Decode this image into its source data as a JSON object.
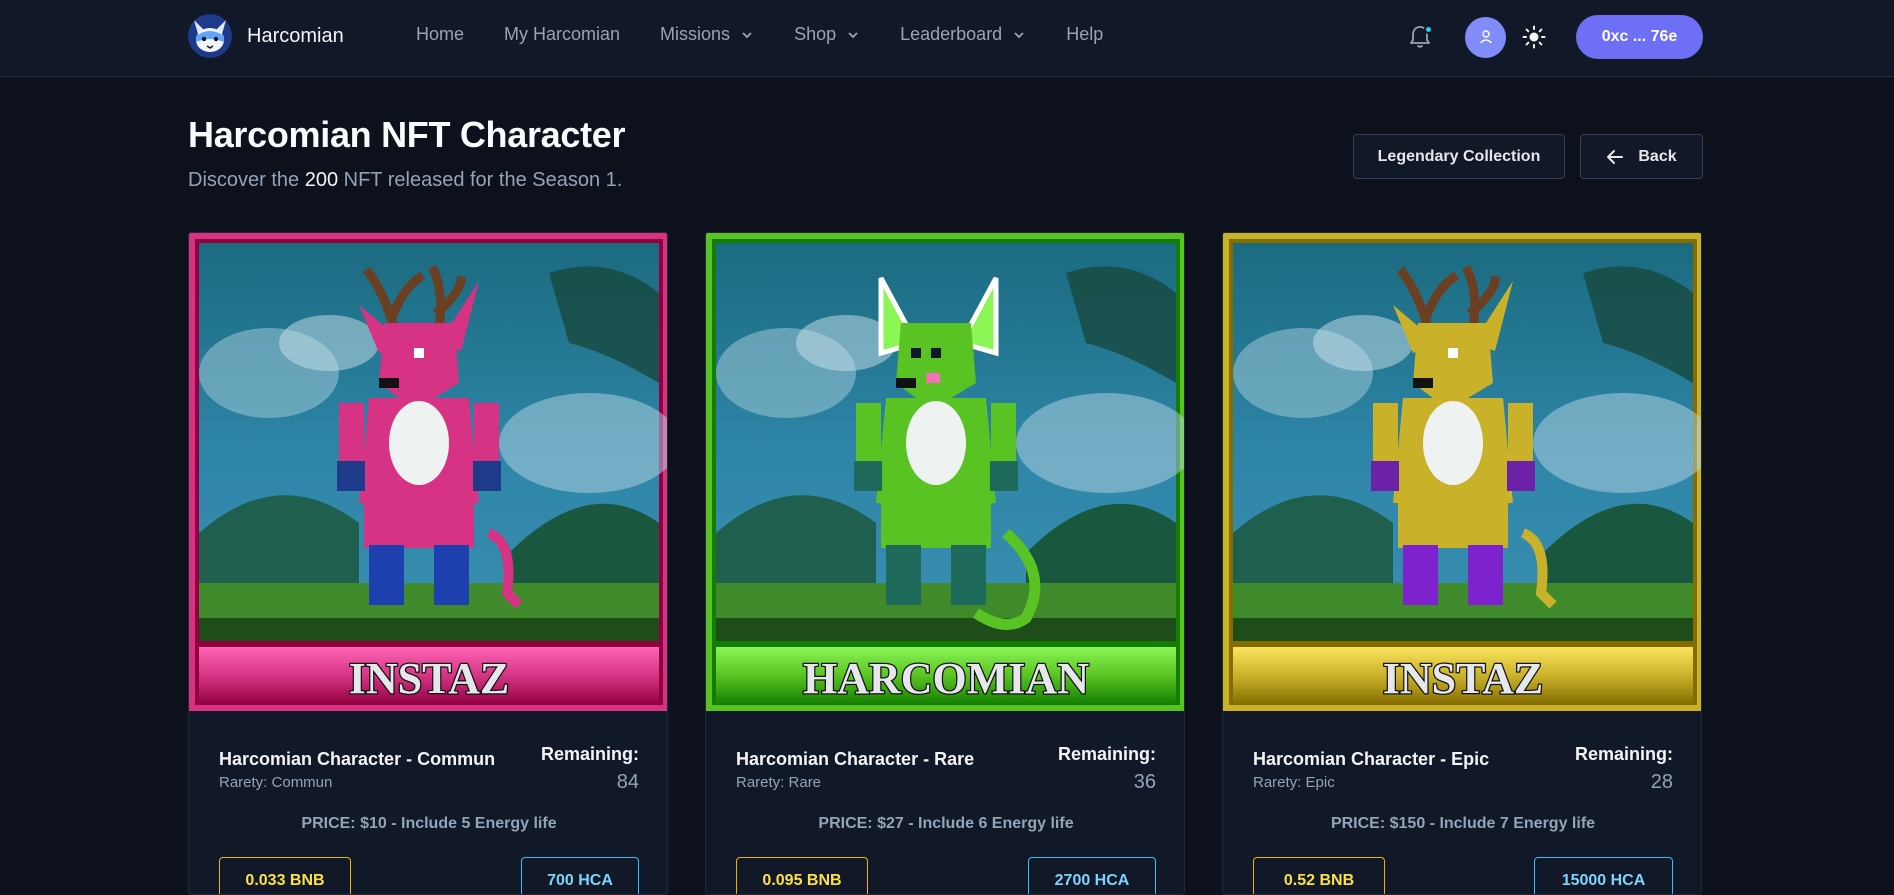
{
  "nav": {
    "brand": "Harcomian",
    "links": [
      {
        "label": "Home",
        "dropdown": false
      },
      {
        "label": "My Harcomian",
        "dropdown": false
      },
      {
        "label": "Missions",
        "dropdown": true
      },
      {
        "label": "Shop",
        "dropdown": true
      },
      {
        "label": "Leaderboard",
        "dropdown": true
      },
      {
        "label": "Help",
        "dropdown": false
      }
    ],
    "wallet": "0xc ... 76e",
    "icons": [
      "bell-icon",
      "user-icon",
      "sun-icon"
    ],
    "accent": "#6d70f5"
  },
  "header": {
    "title": "Harcomian NFT Character",
    "subtitle_pre": "Discover the ",
    "subtitle_count": "200",
    "subtitle_post": " NFT released for the Season 1.",
    "legend_button": "Legendary Collection",
    "back_button": "Back"
  },
  "cards": [
    {
      "banner": "INSTAZ",
      "name": "Harcomian Character - Commun",
      "rarity": "Rarety: Commun",
      "remaining_label": "Remaining:",
      "remaining": "84",
      "price": "PRICE: $10 - Include 5 Energy life",
      "bnb": "0.033 BNB",
      "hca": "700 HCA",
      "color": "#d63384",
      "creature": "deer"
    },
    {
      "banner": "HARCOMIAN",
      "name": "Harcomian Character - Rare",
      "rarity": "Rarety: Rare",
      "remaining_label": "Remaining:",
      "remaining": "36",
      "price": "PRICE: $27 - Include 6 Energy life",
      "bnb": "0.095 BNB",
      "hca": "2700 HCA",
      "color": "#58c322",
      "creature": "cat"
    },
    {
      "banner": "INSTAZ",
      "name": "Harcomian Character - Epic",
      "rarity": "Rarety: Epic",
      "remaining_label": "Remaining:",
      "remaining": "28",
      "price": "PRICE: $150 - Include 7 Energy life",
      "bnb": "0.52 BNB",
      "hca": "15000 HCA",
      "color": "#c9b22a",
      "creature": "deer"
    }
  ]
}
